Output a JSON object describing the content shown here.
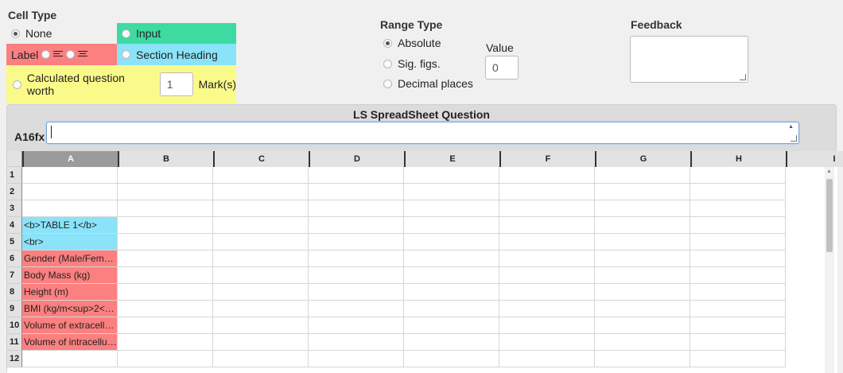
{
  "cell_type": {
    "title": "Cell Type",
    "none_label": "None",
    "input_label": "Input",
    "label_label": "Label",
    "section_heading_label": "Section Heading",
    "calculated_label": "Calculated question worth",
    "marks_value": "1",
    "marks_suffix": "Mark(s)"
  },
  "range_type": {
    "title": "Range Type",
    "absolute_label": "Absolute",
    "sigfigs_label": "Sig. figs.",
    "decimal_label": "Decimal places",
    "value_label": "Value",
    "value": "0"
  },
  "feedback": {
    "title": "Feedback",
    "value": ""
  },
  "sheet": {
    "title": "LS SpreadSheet Question",
    "cell_ref": "A16fx",
    "formula_value": "",
    "columns": [
      "A",
      "B",
      "C",
      "D",
      "E",
      "F",
      "G",
      "H",
      "I"
    ],
    "rows": [
      {
        "num": "1",
        "a": ""
      },
      {
        "num": "2",
        "a": ""
      },
      {
        "num": "3",
        "a": ""
      },
      {
        "num": "4",
        "a": "<b>TABLE 1</b>"
      },
      {
        "num": "5",
        "a": "<br>"
      },
      {
        "num": "6",
        "a": "Gender (Male/Fem…"
      },
      {
        "num": "7",
        "a": "Body Mass (kg)"
      },
      {
        "num": "8",
        "a": "Height (m)"
      },
      {
        "num": "9",
        "a": "BMI (kg/m<sup>2</…"
      },
      {
        "num": "10",
        "a": "Volume of extracell…"
      },
      {
        "num": "11",
        "a": "Volume of intracellu…"
      },
      {
        "num": "12",
        "a": ""
      }
    ],
    "colors": {
      "heading": "#8ae3f8",
      "label": "#fc8080",
      "input": "#3ddba1",
      "calculated": "#fafa8a"
    }
  },
  "icons": {
    "align_left": "align-left-icon",
    "align_center": "align-center-icon"
  }
}
